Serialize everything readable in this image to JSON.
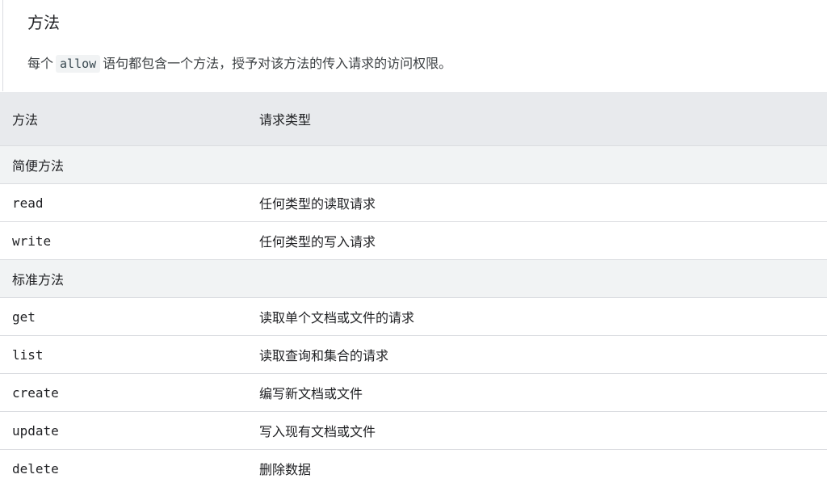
{
  "section": {
    "heading": "方法",
    "intro_before": "每个",
    "intro_code": "allow",
    "intro_after": "语句都包含一个方法，授予对该方法的传入请求的访问权限。"
  },
  "table": {
    "headers": [
      "方法",
      "请求类型"
    ],
    "groups": [
      {
        "title": "简便方法",
        "rows": [
          {
            "method": "read",
            "description": "任何类型的读取请求"
          },
          {
            "method": "write",
            "description": "任何类型的写入请求"
          }
        ]
      },
      {
        "title": "标准方法",
        "rows": [
          {
            "method": "get",
            "description": "读取单个文档或文件的请求"
          },
          {
            "method": "list",
            "description": "读取查询和集合的请求"
          },
          {
            "method": "create",
            "description": "编写新文档或文件"
          },
          {
            "method": "update",
            "description": "写入现有文档或文件"
          },
          {
            "method": "delete",
            "description": "删除数据"
          }
        ]
      }
    ]
  }
}
